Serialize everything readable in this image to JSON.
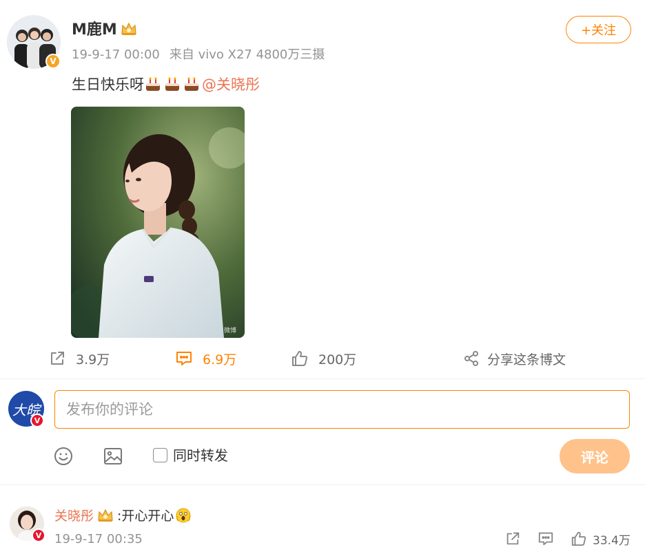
{
  "post": {
    "username": "M鹿M",
    "time": "19-9-17 00:00",
    "source": "来自 vivo X27 4800万三摄",
    "follow_label": "+关注",
    "text_prefix": "生日快乐呀",
    "mention": "@关晓彤",
    "photo_watermark": "微博"
  },
  "actions": {
    "repost_count": "3.9万",
    "comment_count": "6.9万",
    "like_count": "200万",
    "share_label": "分享这条博文"
  },
  "composer": {
    "avatar_text": "大皖",
    "placeholder": "发布你的评论",
    "sync_label": "同时转发",
    "submit_label": "评论"
  },
  "reply": {
    "username": "关晓彤",
    "text": ":开心开心",
    "time": "19-9-17 00:35",
    "like_count": "33.4万"
  },
  "badges": {
    "verified": "V"
  },
  "icons": [
    "crown-icon",
    "cake-icon",
    "repost-icon",
    "comment-icon",
    "like-icon",
    "share-icon",
    "emoji-icon",
    "image-icon",
    "scream-icon"
  ],
  "colors": {
    "accent": "#ff8200",
    "mention": "#eb7350",
    "submit_disabled": "#ffc28a",
    "muted": "#939393"
  }
}
